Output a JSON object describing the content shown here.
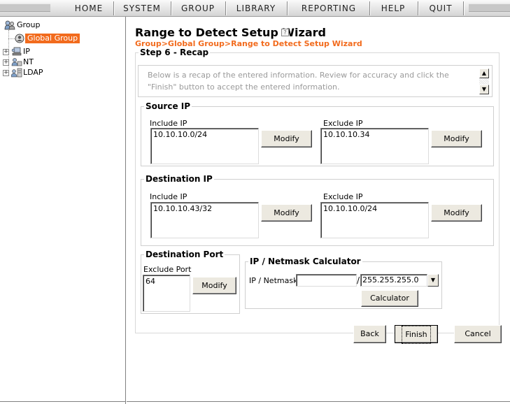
{
  "nav": {
    "items": [
      "HOME",
      "SYSTEM",
      "GROUP",
      "LIBRARY",
      "REPORTING",
      "HELP",
      "QUIT"
    ]
  },
  "tree": {
    "root": "Group",
    "selected": "Global Group",
    "children": [
      "IP",
      "NT",
      "LDAP"
    ]
  },
  "header": {
    "title": "Range to Detect Setup Wizard",
    "breadcrumb": "Group>Global Group>Range to Detect Setup Wizard"
  },
  "step": {
    "title": "Step 6 - Recap",
    "recap_text": "Below is a recap of the entered information. Review for accuracy and click the \"Finish\" button to accept the entered information."
  },
  "source_ip": {
    "title": "Source IP",
    "include_label": "Include IP",
    "include_value": "10.10.10.0/24",
    "include_button": "Modify",
    "exclude_label": "Exclude IP",
    "exclude_value": "10.10.10.34",
    "exclude_button": "Modify"
  },
  "destination_ip": {
    "title": "Destination IP",
    "include_label": "Include IP",
    "include_value": "10.10.10.43/32",
    "include_button": "Modify",
    "exclude_label": "Exclude IP",
    "exclude_value": "10.10.10.0/24",
    "exclude_button": "Modify"
  },
  "destination_port": {
    "title": "Destination Port",
    "exclude_label": "Exclude Port",
    "exclude_value": "64",
    "button": "Modify"
  },
  "calculator": {
    "title": "IP / Netmask Calculator",
    "field_label": "IP / Netmask",
    "ip_value": "",
    "separator": "/",
    "netmask_value": "255.255.255.0",
    "button": "Calculator"
  },
  "actions": {
    "back": "Back",
    "finish": "Finish",
    "cancel": "Cancel"
  },
  "colors": {
    "accent": "#f26b1d"
  }
}
